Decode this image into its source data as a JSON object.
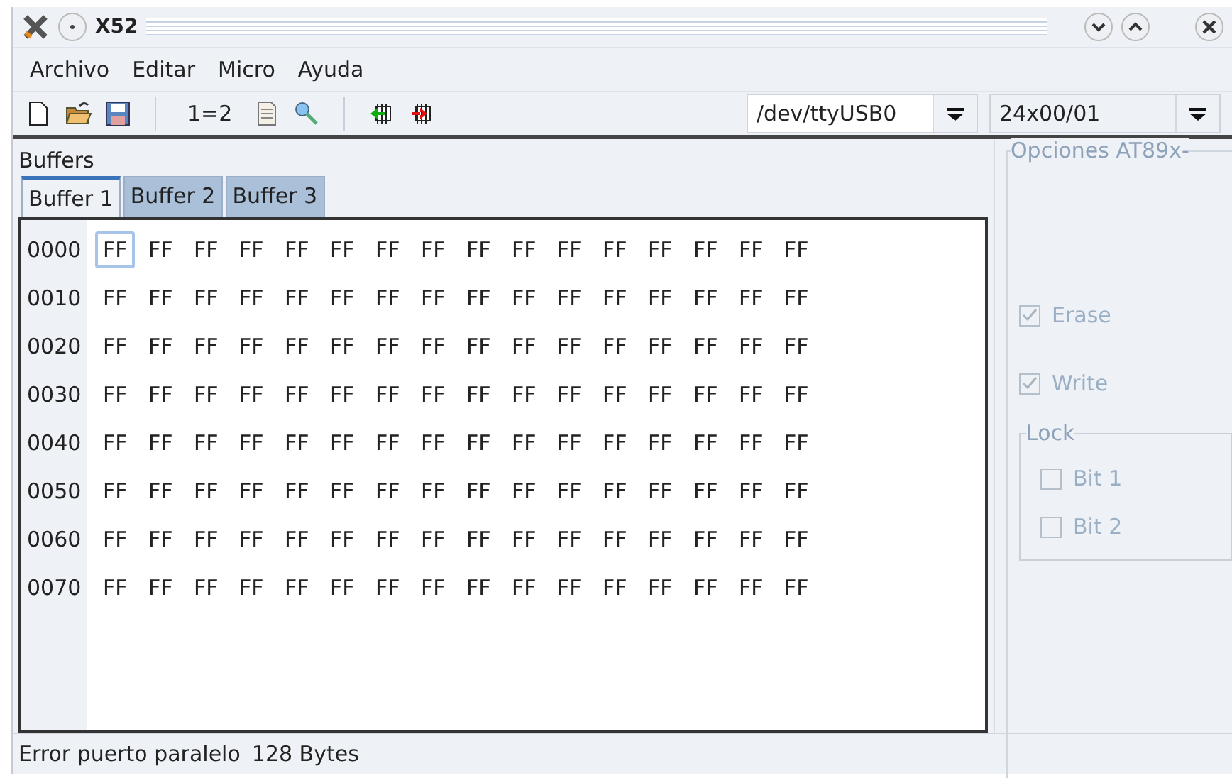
{
  "window": {
    "title": "X52"
  },
  "menu": [
    "Archivo",
    "Editar",
    "Micro",
    "Ayuda"
  ],
  "toolbar": {
    "compare": "1=2",
    "port": "/dev/ttyUSB0",
    "device": "24x00/01"
  },
  "buffers": {
    "title": "Buffers",
    "tabs": [
      {
        "label": "Buffer 1",
        "selected": true
      },
      {
        "label": "Buffer 2",
        "selected": false
      },
      {
        "label": "Buffer 3",
        "selected": false
      }
    ],
    "rows": [
      {
        "address": "0000",
        "bytes": [
          {
            "v": "FF",
            "selected": true
          },
          {
            "v": "FF",
            "selected": false
          },
          {
            "v": "FF",
            "selected": false
          },
          {
            "v": "FF",
            "selected": false
          },
          {
            "v": "FF",
            "selected": false
          },
          {
            "v": "FF",
            "selected": false
          },
          {
            "v": "FF",
            "selected": false
          },
          {
            "v": "FF",
            "selected": false
          },
          {
            "v": "FF",
            "selected": false
          },
          {
            "v": "FF",
            "selected": false
          },
          {
            "v": "FF",
            "selected": false
          },
          {
            "v": "FF",
            "selected": false
          },
          {
            "v": "FF",
            "selected": false
          },
          {
            "v": "FF",
            "selected": false
          },
          {
            "v": "FF",
            "selected": false
          },
          {
            "v": "FF",
            "selected": false
          }
        ]
      },
      {
        "address": "0010",
        "bytes": [
          {
            "v": "FF",
            "selected": false
          },
          {
            "v": "FF",
            "selected": false
          },
          {
            "v": "FF",
            "selected": false
          },
          {
            "v": "FF",
            "selected": false
          },
          {
            "v": "FF",
            "selected": false
          },
          {
            "v": "FF",
            "selected": false
          },
          {
            "v": "FF",
            "selected": false
          },
          {
            "v": "FF",
            "selected": false
          },
          {
            "v": "FF",
            "selected": false
          },
          {
            "v": "FF",
            "selected": false
          },
          {
            "v": "FF",
            "selected": false
          },
          {
            "v": "FF",
            "selected": false
          },
          {
            "v": "FF",
            "selected": false
          },
          {
            "v": "FF",
            "selected": false
          },
          {
            "v": "FF",
            "selected": false
          },
          {
            "v": "FF",
            "selected": false
          }
        ]
      },
      {
        "address": "0020",
        "bytes": [
          {
            "v": "FF",
            "selected": false
          },
          {
            "v": "FF",
            "selected": false
          },
          {
            "v": "FF",
            "selected": false
          },
          {
            "v": "FF",
            "selected": false
          },
          {
            "v": "FF",
            "selected": false
          },
          {
            "v": "FF",
            "selected": false
          },
          {
            "v": "FF",
            "selected": false
          },
          {
            "v": "FF",
            "selected": false
          },
          {
            "v": "FF",
            "selected": false
          },
          {
            "v": "FF",
            "selected": false
          },
          {
            "v": "FF",
            "selected": false
          },
          {
            "v": "FF",
            "selected": false
          },
          {
            "v": "FF",
            "selected": false
          },
          {
            "v": "FF",
            "selected": false
          },
          {
            "v": "FF",
            "selected": false
          },
          {
            "v": "FF",
            "selected": false
          }
        ]
      },
      {
        "address": "0030",
        "bytes": [
          {
            "v": "FF",
            "selected": false
          },
          {
            "v": "FF",
            "selected": false
          },
          {
            "v": "FF",
            "selected": false
          },
          {
            "v": "FF",
            "selected": false
          },
          {
            "v": "FF",
            "selected": false
          },
          {
            "v": "FF",
            "selected": false
          },
          {
            "v": "FF",
            "selected": false
          },
          {
            "v": "FF",
            "selected": false
          },
          {
            "v": "FF",
            "selected": false
          },
          {
            "v": "FF",
            "selected": false
          },
          {
            "v": "FF",
            "selected": false
          },
          {
            "v": "FF",
            "selected": false
          },
          {
            "v": "FF",
            "selected": false
          },
          {
            "v": "FF",
            "selected": false
          },
          {
            "v": "FF",
            "selected": false
          },
          {
            "v": "FF",
            "selected": false
          }
        ]
      },
      {
        "address": "0040",
        "bytes": [
          {
            "v": "FF",
            "selected": false
          },
          {
            "v": "FF",
            "selected": false
          },
          {
            "v": "FF",
            "selected": false
          },
          {
            "v": "FF",
            "selected": false
          },
          {
            "v": "FF",
            "selected": false
          },
          {
            "v": "FF",
            "selected": false
          },
          {
            "v": "FF",
            "selected": false
          },
          {
            "v": "FF",
            "selected": false
          },
          {
            "v": "FF",
            "selected": false
          },
          {
            "v": "FF",
            "selected": false
          },
          {
            "v": "FF",
            "selected": false
          },
          {
            "v": "FF",
            "selected": false
          },
          {
            "v": "FF",
            "selected": false
          },
          {
            "v": "FF",
            "selected": false
          },
          {
            "v": "FF",
            "selected": false
          },
          {
            "v": "FF",
            "selected": false
          }
        ]
      },
      {
        "address": "0050",
        "bytes": [
          {
            "v": "FF",
            "selected": false
          },
          {
            "v": "FF",
            "selected": false
          },
          {
            "v": "FF",
            "selected": false
          },
          {
            "v": "FF",
            "selected": false
          },
          {
            "v": "FF",
            "selected": false
          },
          {
            "v": "FF",
            "selected": false
          },
          {
            "v": "FF",
            "selected": false
          },
          {
            "v": "FF",
            "selected": false
          },
          {
            "v": "FF",
            "selected": false
          },
          {
            "v": "FF",
            "selected": false
          },
          {
            "v": "FF",
            "selected": false
          },
          {
            "v": "FF",
            "selected": false
          },
          {
            "v": "FF",
            "selected": false
          },
          {
            "v": "FF",
            "selected": false
          },
          {
            "v": "FF",
            "selected": false
          },
          {
            "v": "FF",
            "selected": false
          }
        ]
      },
      {
        "address": "0060",
        "bytes": [
          {
            "v": "FF",
            "selected": false
          },
          {
            "v": "FF",
            "selected": false
          },
          {
            "v": "FF",
            "selected": false
          },
          {
            "v": "FF",
            "selected": false
          },
          {
            "v": "FF",
            "selected": false
          },
          {
            "v": "FF",
            "selected": false
          },
          {
            "v": "FF",
            "selected": false
          },
          {
            "v": "FF",
            "selected": false
          },
          {
            "v": "FF",
            "selected": false
          },
          {
            "v": "FF",
            "selected": false
          },
          {
            "v": "FF",
            "selected": false
          },
          {
            "v": "FF",
            "selected": false
          },
          {
            "v": "FF",
            "selected": false
          },
          {
            "v": "FF",
            "selected": false
          },
          {
            "v": "FF",
            "selected": false
          },
          {
            "v": "FF",
            "selected": false
          }
        ]
      },
      {
        "address": "0070",
        "bytes": [
          {
            "v": "FF",
            "selected": false
          },
          {
            "v": "FF",
            "selected": false
          },
          {
            "v": "FF",
            "selected": false
          },
          {
            "v": "FF",
            "selected": false
          },
          {
            "v": "FF",
            "selected": false
          },
          {
            "v": "FF",
            "selected": false
          },
          {
            "v": "FF",
            "selected": false
          },
          {
            "v": "FF",
            "selected": false
          },
          {
            "v": "FF",
            "selected": false
          },
          {
            "v": "FF",
            "selected": false
          },
          {
            "v": "FF",
            "selected": false
          },
          {
            "v": "FF",
            "selected": false
          },
          {
            "v": "FF",
            "selected": false
          },
          {
            "v": "FF",
            "selected": false
          },
          {
            "v": "FF",
            "selected": false
          },
          {
            "v": "FF",
            "selected": false
          }
        ]
      }
    ]
  },
  "options": {
    "title": "Opciones AT89x-",
    "disabled": true,
    "checks": [
      {
        "label": "Erase",
        "checked": true
      },
      {
        "label": "Write",
        "checked": true
      }
    ],
    "lock": {
      "title": "Lock",
      "checks": [
        {
          "label": "Bit 1",
          "checked": false
        },
        {
          "label": "Bit 2",
          "checked": false
        }
      ]
    }
  },
  "status_bar": [
    "Error puerto paralelo",
    "128 Bytes"
  ]
}
